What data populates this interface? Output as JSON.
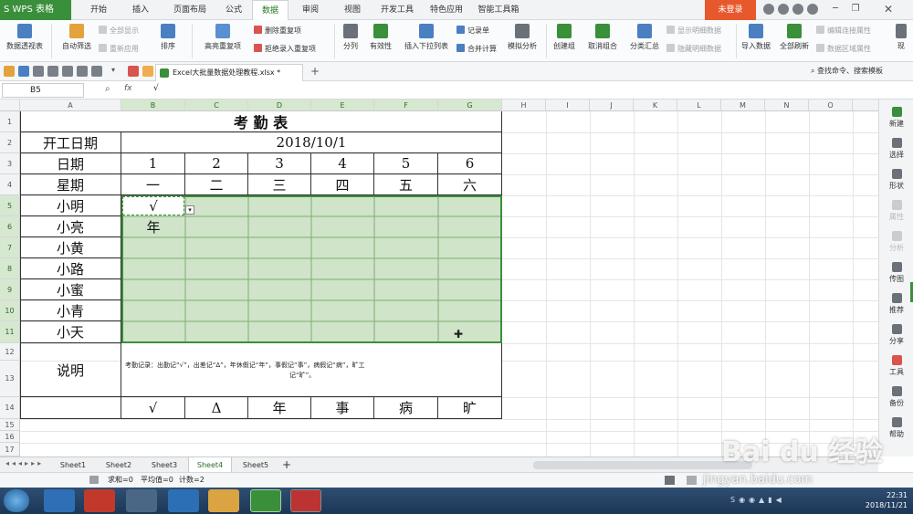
{
  "app": {
    "logo_label": "S WPS 表格",
    "login_label": "未登录"
  },
  "menu": {
    "tabs": [
      "开始",
      "插入",
      "页面布局",
      "公式",
      "数据",
      "审阅",
      "视图",
      "开发工具",
      "特色应用",
      "智能工具箱"
    ]
  },
  "ribbon": {
    "pivot": "数据透视表",
    "autofilter": "自动筛选",
    "show_all": "全部显示",
    "reapply": "重新应用",
    "sort": "排序",
    "highlight_dup": "高亮重复项",
    "remove_dup": "删除重复项",
    "reject_dup": "拒绝录入重复项",
    "split": "分列",
    "validity": "有效性",
    "dropdown_list": "插入下拉列表",
    "record_form": "记录单",
    "consolidate": "合并计算",
    "whatif": "模拟分析",
    "group": "创建组",
    "ungroup": "取消组合",
    "subtotal": "分类汇总",
    "show_detail": "显示明细数据",
    "hide_detail": "隐藏明细数据",
    "import": "导入数据",
    "refresh_all": "全部刷新",
    "edit_links": "编辑连接属性",
    "range_props": "数据区域属性",
    "current": "现"
  },
  "toolbar": {
    "doc_tab": "Excel大批量数据处理教程.xlsx *",
    "search": "查找命令、搜索模板"
  },
  "formula": {
    "name_box": "B5",
    "fx": "fx",
    "content": "√"
  },
  "columns": [
    "A",
    "B",
    "C",
    "D",
    "E",
    "F",
    "G",
    "H",
    "I",
    "J",
    "K",
    "L",
    "M",
    "N",
    "O"
  ],
  "rows": [
    "1",
    "2",
    "3",
    "4",
    "5",
    "6",
    "7",
    "8",
    "9",
    "10",
    "11",
    "12",
    "13",
    "14",
    "15",
    "16",
    "17"
  ],
  "sheet": {
    "title": "考 勤 表",
    "start_label": "开工日期",
    "start_date": "2018/10/1",
    "date_label": "日期",
    "dates": [
      "1",
      "2",
      "3",
      "4",
      "5",
      "6"
    ],
    "weekday_label": "星期",
    "weekdays": [
      "一",
      "二",
      "三",
      "四",
      "五",
      "六"
    ],
    "names": [
      "小明",
      "小亮",
      "小黄",
      "小路",
      "小蜜",
      "小青",
      "小天"
    ],
    "b5": "√",
    "b6": "年",
    "note_label": "说明",
    "note_text_1": "考勤记录：出勤记“√”，出差记“Δ”，年休假记“年”，事假记“事”，病假记“病”，旷工",
    "note_text_2": "记“旷”。",
    "symbols": [
      "√",
      "Δ",
      "年",
      "事",
      "病",
      "旷"
    ]
  },
  "side_panel": [
    "新建",
    "选择",
    "形状",
    "属性",
    "分析",
    "传图",
    "推荐",
    "分享",
    "工具",
    "备份",
    "帮助"
  ],
  "sheet_tabs": [
    "Sheet1",
    "Sheet2",
    "Sheet3",
    "Sheet4",
    "Sheet5"
  ],
  "active_sheet": "Sheet4",
  "status": {
    "sum": "求和=0",
    "avg": "平均值=0",
    "count": "计数=2"
  },
  "taskbar": {
    "time": "22:31",
    "date": "2018/11/21"
  },
  "watermark": {
    "logo": "Bai du 经验",
    "url": "jingyan.baidu.com"
  },
  "colors": {
    "accent": "#3a8f3a",
    "selection": "#cfe4c8",
    "login": "#e7582c"
  }
}
